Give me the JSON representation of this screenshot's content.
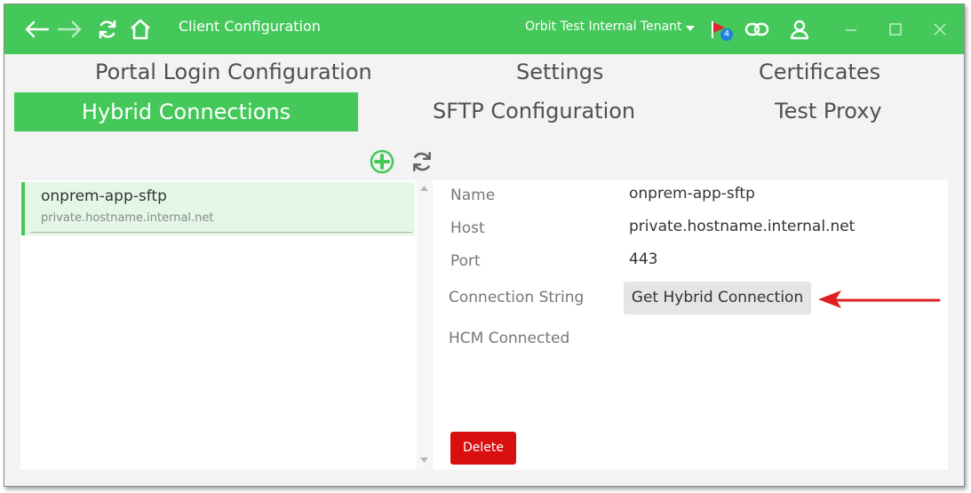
{
  "titlebar": {
    "title": "Client Configuration",
    "tenant": "Orbit Test Internal Tenant",
    "notification_count": "4",
    "icons": [
      "back-arrow-icon",
      "forward-arrow-icon",
      "refresh-icon",
      "home-icon",
      "flag-icon",
      "link-icon",
      "user-icon",
      "minimize-icon",
      "maximize-icon",
      "close-icon"
    ],
    "colors": {
      "bar": "#44c85a",
      "badge": "#1f7fe0"
    }
  },
  "tabs": {
    "portal_login": "Portal Login Configuration",
    "settings": "Settings",
    "certificates": "Certificates",
    "hybrid_connections": "Hybrid Connections",
    "sftp_configuration": "SFTP Configuration",
    "test_proxy": "Test Proxy",
    "active": "Hybrid Connections"
  },
  "toolbar": {
    "icons": [
      "add-icon",
      "refresh-icon"
    ]
  },
  "list": {
    "items": [
      {
        "name": "onprem-app-sftp",
        "host": "private.hostname.internal.net"
      }
    ]
  },
  "details": {
    "name_label": "Name",
    "name_value": "onprem-app-sftp",
    "host_label": "Host",
    "host_value": "private.hostname.internal.net",
    "port_label": "Port",
    "port_value": "443",
    "connection_string_label": "Connection String",
    "get_hybrid_connection_label": "Get Hybrid Connection",
    "hcm_connected_label": "HCM Connected",
    "delete_label": "Delete"
  },
  "colors": {
    "accent": "#44c85a",
    "delete": "#d90f0f",
    "annotation_arrow": "#e02020"
  }
}
